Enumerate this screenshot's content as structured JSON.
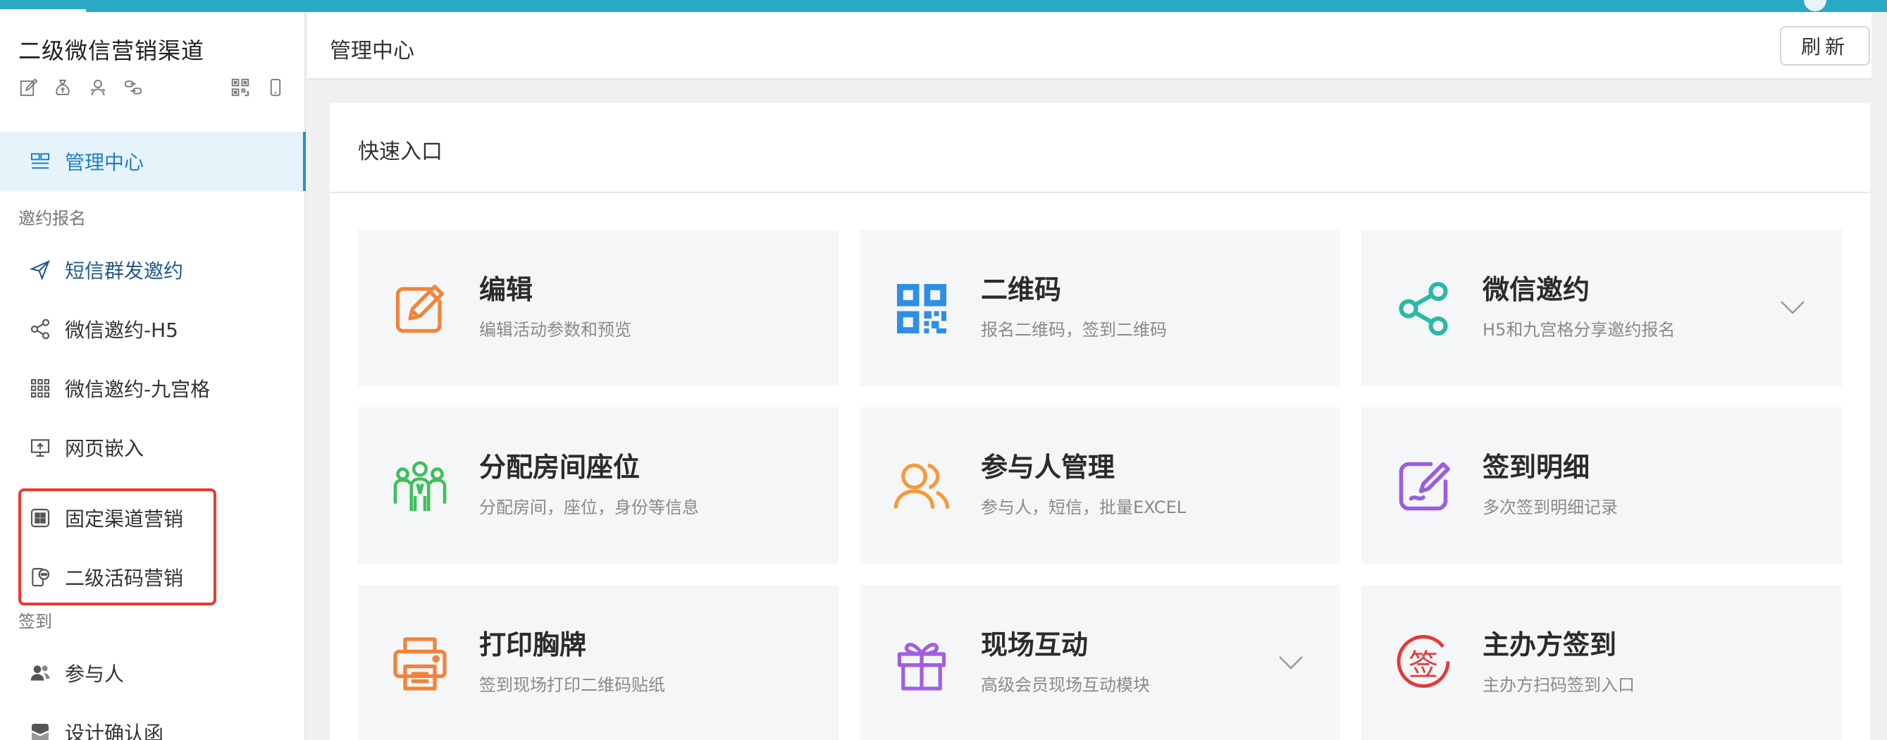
{
  "app": {
    "title": "二级微信营销渠道"
  },
  "toolbar": {
    "icons": [
      "edit-icon",
      "money-bag-icon",
      "user-icon",
      "link-icon",
      "qrcode-icon",
      "phone-icon"
    ]
  },
  "sidebar": {
    "active": {
      "label": "管理中心",
      "icon": "dashboard-icon"
    },
    "section_invite": "邀约报名",
    "invite_items": [
      {
        "label": "短信群发邀约",
        "icon": "send-icon"
      },
      {
        "label": "微信邀约-H5",
        "icon": "share-icon"
      },
      {
        "label": "微信邀约-九宫格",
        "icon": "grid-icon"
      },
      {
        "label": "网页嵌入",
        "icon": "monitor-icon"
      },
      {
        "label": "固定渠道营销",
        "icon": "channel-icon"
      },
      {
        "label": "二级活码营销",
        "icon": "phone-chat-icon"
      }
    ],
    "section_signin": "签到",
    "signin_items": [
      {
        "label": "参与人",
        "icon": "people-icon"
      },
      {
        "label": "设计确认函",
        "icon": "letter-icon"
      }
    ]
  },
  "header": {
    "title": "管理中心",
    "refresh_label": "刷新"
  },
  "quick": {
    "title": "快速入口",
    "cards": [
      {
        "title": "编辑",
        "desc": "编辑活动参数和预览",
        "icon": "edit-icon",
        "color": "#f0843c"
      },
      {
        "title": "二维码",
        "desc": "报名二维码，签到二维码",
        "icon": "qrcode-icon",
        "color": "#2d8ee5"
      },
      {
        "title": "微信邀约",
        "desc": "H5和九宫格分享邀约报名",
        "icon": "share-icon",
        "color": "#2bb9a5"
      },
      {
        "title": "分配房间座位",
        "desc": "分配房间，座位，身份等信息",
        "icon": "team-icon",
        "color": "#3cc05a"
      },
      {
        "title": "参与人管理",
        "desc": "参与人，短信，批量EXCEL",
        "icon": "users-icon",
        "color": "#f39a3c"
      },
      {
        "title": "签到明细",
        "desc": "多次签到明细记录",
        "icon": "sign-edit-icon",
        "color": "#9a5ee0"
      },
      {
        "title": "打印胸牌",
        "desc": "签到现场打印二维码贴纸",
        "icon": "printer-icon",
        "color": "#f0843c"
      },
      {
        "title": "现场互动",
        "desc": "高级会员现场互动模块",
        "icon": "gift-icon",
        "color": "#a35ee0"
      },
      {
        "title": "主办方签到",
        "desc": "主办方扫码签到入口",
        "icon": "sign-stamp-icon",
        "color": "#e23a3a",
        "glyph": "签"
      }
    ]
  },
  "colors": {
    "accent": "#29a9c4",
    "active_nav": "#1c7fc6",
    "highlight": "#e83b2e"
  }
}
